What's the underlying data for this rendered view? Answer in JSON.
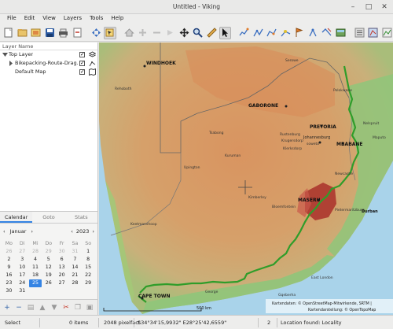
{
  "window": {
    "title": "Untitled - Viking",
    "minimize": "–",
    "maximize": "□",
    "close": "✕"
  },
  "menubar": [
    "File",
    "Edit",
    "View",
    "Layers",
    "Tools",
    "Help"
  ],
  "layers_panel": {
    "header": "Layer Name",
    "items": [
      {
        "label": "Top Layer",
        "checked": true
      },
      {
        "label": "Bikepacking-Route-Drag...",
        "checked": true
      },
      {
        "label": "Default Map",
        "checked": true
      }
    ]
  },
  "calendar": {
    "tabs": [
      "Calendar",
      "Goto",
      "Stats"
    ],
    "active_tab": "Calendar",
    "month": "Januar",
    "year": "2023",
    "weekdays": [
      "Mo",
      "Di",
      "Mi",
      "Do",
      "Fr",
      "Sa",
      "So"
    ],
    "weeks": [
      [
        "26",
        "27",
        "28",
        "29",
        "30",
        "31",
        "1"
      ],
      [
        "2",
        "3",
        "4",
        "5",
        "6",
        "7",
        "8"
      ],
      [
        "9",
        "10",
        "11",
        "12",
        "13",
        "14",
        "15"
      ],
      [
        "16",
        "17",
        "18",
        "19",
        "20",
        "21",
        "22"
      ],
      [
        "23",
        "24",
        "25",
        "26",
        "27",
        "28",
        "29"
      ],
      [
        "30",
        "31",
        "",
        "",
        "",
        "",
        ""
      ]
    ],
    "selected_day": "25",
    "prev": "‹",
    "next": "›"
  },
  "map": {
    "labels": {
      "windhoek": "WINDHOEK",
      "gaborone": "GABORONE",
      "pretoria": "PRETORIA",
      "johannesburg": "Johannesburg",
      "soweto": "soweto",
      "mbabane": "MBABANE",
      "maseru": "MASERU",
      "cape_town": "CAPE TOWN",
      "polokwane": "Polokwane",
      "rustenburg": "Rustenburg",
      "krugersdorp": "Krugersdorp",
      "klerksdorp": "Klerksdorp",
      "kimberley": "Kimberley",
      "bloemfontein": "Bloemfontein",
      "upington": "Upington",
      "durban": "Durban",
      "pietermaritzburg": "Pietermaritzburg",
      "east_london": "East London",
      "gqeberha": "Gqeberha",
      "george": "George",
      "rehoboth": "Rehoboth",
      "serowe": "Serowe",
      "keetmanshoop": "Keetmanshoop",
      "nelspruit": "Nelspruit",
      "maputo": "Maputo",
      "newcastle": "Newcastle",
      "kuruman": "Kuruman",
      "tsabong": "Tsabong"
    },
    "scale_label": "500 km",
    "attribution_1": "Kartendaten: © OpenStreetMap-Mitwirkende, SRTM | ",
    "attribution_2": "Kartendarstellung: © OpenTopoMap",
    "colors": {
      "track": "#2f9d2a",
      "sea": "#a9d3ea",
      "lowland": "#8fc57a",
      "plateau": "#d59a62",
      "mountain": "#a9302a"
    }
  },
  "statusbar": {
    "item_name": "Select",
    "items": "0 items",
    "zoom": "2048 pixelfact",
    "coords": "S34°34'15,9932\" E28°25'42,6559\"",
    "num": "2",
    "location": "Location found: Locality"
  }
}
